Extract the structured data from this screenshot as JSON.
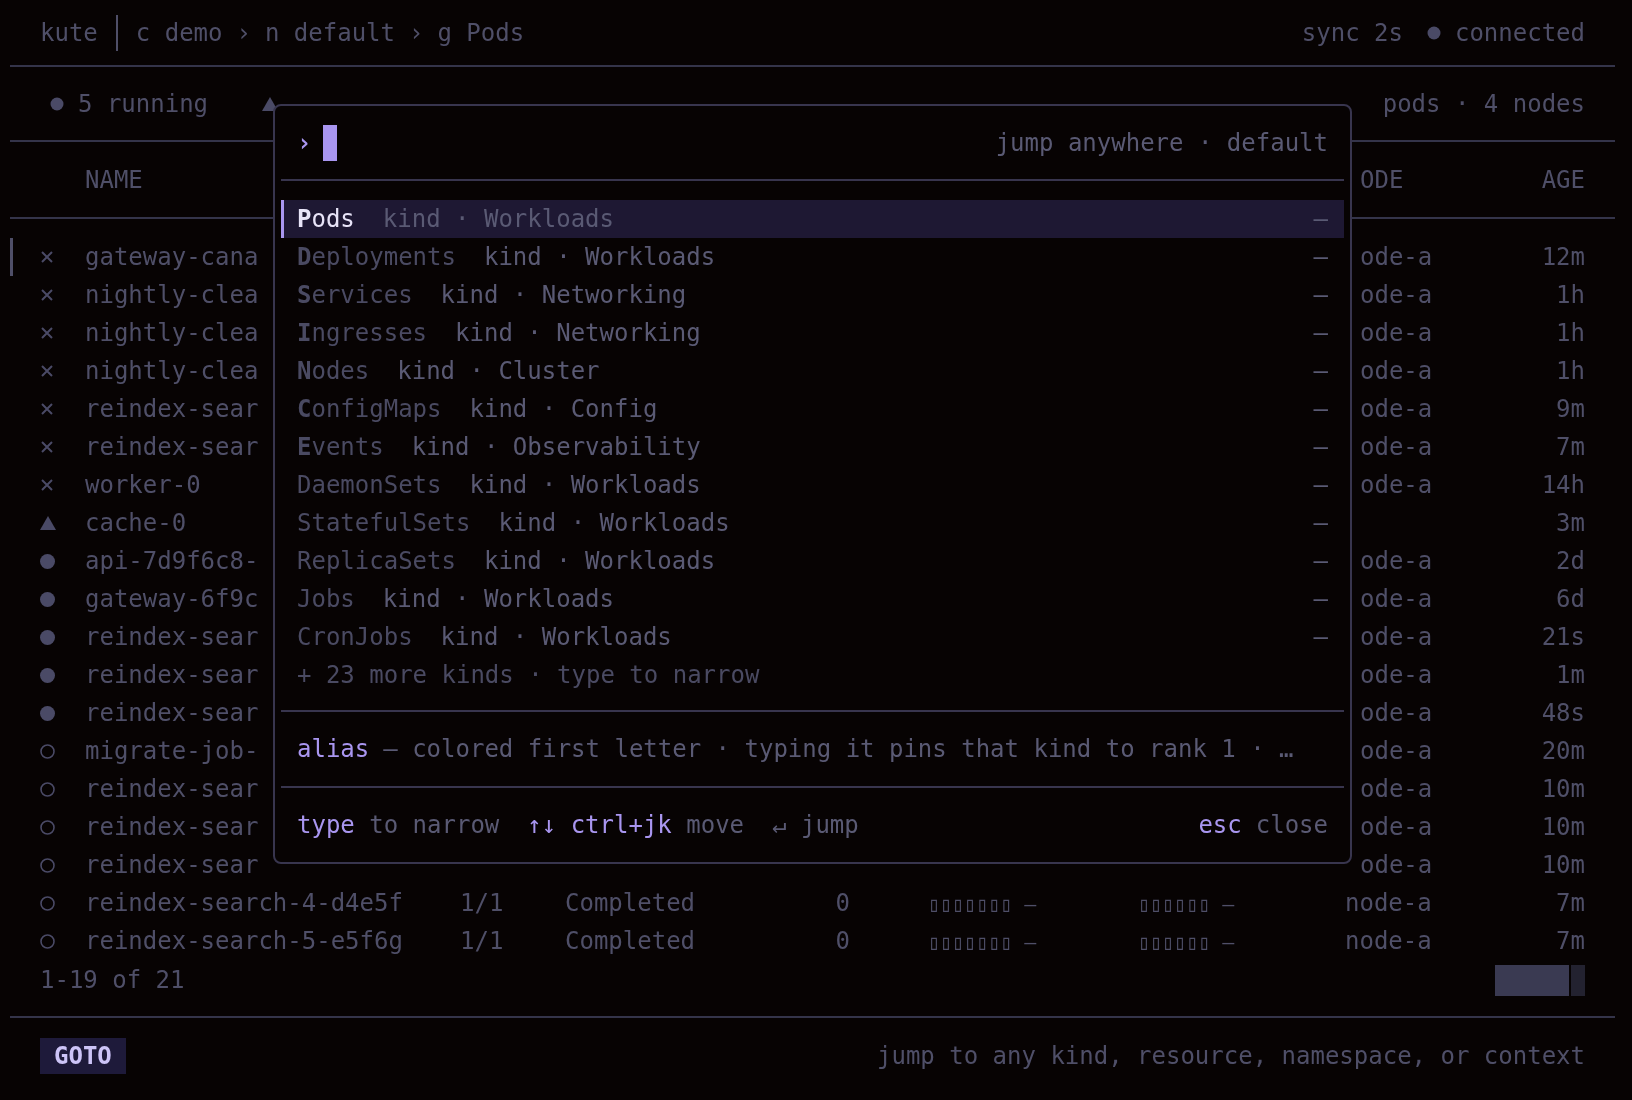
{
  "top_bar": {
    "app": "kute",
    "crumbs": [
      "c demo",
      "n default",
      "g Pods"
    ],
    "separator": "›",
    "sync": "sync 2s",
    "connection": "connected"
  },
  "status_line": {
    "running": "5 running",
    "pending_icon": true,
    "summary": "pods · 4 nodes"
  },
  "table": {
    "columns": {
      "name": "NAME",
      "node": "ODE",
      "age": "AGE"
    },
    "rows": [
      {
        "kind": "failed",
        "selected": true,
        "name": "gateway-cana",
        "node": "ode-a",
        "age": "12m"
      },
      {
        "kind": "failed",
        "selected": false,
        "name": "nightly-clea",
        "node": "ode-a",
        "age": "1h"
      },
      {
        "kind": "failed",
        "selected": false,
        "name": "nightly-clea",
        "node": "ode-a",
        "age": "1h"
      },
      {
        "kind": "failed",
        "selected": false,
        "name": "nightly-clea",
        "node": "ode-a",
        "age": "1h"
      },
      {
        "kind": "failed",
        "selected": false,
        "name": "reindex-sear",
        "node": "ode-a",
        "age": "9m"
      },
      {
        "kind": "failed",
        "selected": false,
        "name": "reindex-sear",
        "node": "ode-a",
        "age": "7m"
      },
      {
        "kind": "failed",
        "selected": false,
        "name": "worker-0",
        "node": "ode-a",
        "age": "14h"
      },
      {
        "kind": "pending",
        "selected": false,
        "name": "cache-0",
        "age": "3m"
      },
      {
        "kind": "running",
        "selected": false,
        "name": "api-7d9f6c8-",
        "node": "ode-a",
        "age": "2d"
      },
      {
        "kind": "running",
        "selected": false,
        "name": "gateway-6f9c",
        "node": "ode-a",
        "age": "6d"
      },
      {
        "kind": "running",
        "selected": false,
        "name": "reindex-sear",
        "node": "ode-a",
        "age": "21s"
      },
      {
        "kind": "running",
        "selected": false,
        "name": "reindex-sear",
        "node": "ode-a",
        "age": "1m"
      },
      {
        "kind": "running",
        "selected": false,
        "name": "reindex-sear",
        "node": "ode-a",
        "age": "48s"
      },
      {
        "kind": "completed",
        "selected": false,
        "name": "migrate-job-",
        "node": "ode-a",
        "age": "20m"
      },
      {
        "kind": "completed",
        "selected": false,
        "name": "reindex-sear",
        "node": "ode-a",
        "age": "10m"
      },
      {
        "kind": "completed",
        "selected": false,
        "name": "reindex-sear",
        "node": "ode-a",
        "age": "10m"
      },
      {
        "kind": "completed",
        "selected": false,
        "name": "reindex-sear",
        "node": "ode-a",
        "age": "10m"
      },
      {
        "kind": "completed",
        "selected": false,
        "name": "reindex-search-4-d4e5f",
        "ready": "1/1",
        "phase": "Completed",
        "restarts": "0",
        "cpu": "▯▯▯▯▯▯▯ –",
        "mem": "▯▯▯▯▯▯ –",
        "node": "node-a",
        "age": "7m"
      },
      {
        "kind": "completed",
        "selected": false,
        "name": "reindex-search-5-e5f6g",
        "ready": "1/1",
        "phase": "Completed",
        "restarts": "0",
        "cpu": "▯▯▯▯▯▯▯ –",
        "mem": "▯▯▯▯▯▯ –",
        "node": "node-a",
        "age": "7m"
      }
    ],
    "range": "1-19 of 21"
  },
  "palette": {
    "prompt": "›",
    "hint": "jump anywhere · default",
    "items": [
      {
        "name": "**P**ods",
        "meta": "kind · Workloads",
        "mark": "–",
        "selected": true
      },
      {
        "name": "**D**eployments",
        "meta": "kind · Workloads",
        "mark": "–",
        "selected": false
      },
      {
        "name": "**S**ervices",
        "meta": "kind · Networking",
        "mark": "–",
        "selected": false
      },
      {
        "name": "**I**ngresses",
        "meta": "kind · Networking",
        "mark": "–",
        "selected": false
      },
      {
        "name": "**N**odes",
        "meta": "kind · Cluster",
        "mark": "–",
        "selected": false
      },
      {
        "name": "**C**onfigMaps",
        "meta": "kind · Config",
        "mark": "–",
        "selected": false
      },
      {
        "name": "**E**vents",
        "meta": "kind · Observability",
        "mark": "–",
        "selected": false
      },
      {
        "name": "DaemonSets",
        "meta": "kind · Workloads",
        "mark": "–",
        "selected": false
      },
      {
        "name": "StatefulSets",
        "meta": "kind · Workloads",
        "mark": "–",
        "selected": false
      },
      {
        "name": "ReplicaSets",
        "meta": "kind · Workloads",
        "mark": "–",
        "selected": false
      },
      {
        "name": "Jobs",
        "meta": "kind · Workloads",
        "mark": "–",
        "selected": false
      },
      {
        "name": "CronJobs",
        "meta": "kind · Workloads",
        "mark": "–",
        "selected": false
      }
    ],
    "more": "+ 23 more kinds · type to narrow",
    "alias": {
      "label": "alias",
      "text": "— colored first letter · typing it pins that kind to rank 1 · …"
    },
    "hints": [
      {
        "key": "type",
        "action": "to narrow",
        "accent": true
      },
      {
        "key": "↑↓ ctrl+jk",
        "action": "move",
        "accent": true
      },
      {
        "key": "↵",
        "action": "jump",
        "accent": false
      }
    ],
    "close_hint": {
      "key": "esc",
      "action": "close",
      "accent": true
    }
  },
  "footer": {
    "mode": "GOTO",
    "help": "jump to any kind, resource, namespace, or context"
  }
}
